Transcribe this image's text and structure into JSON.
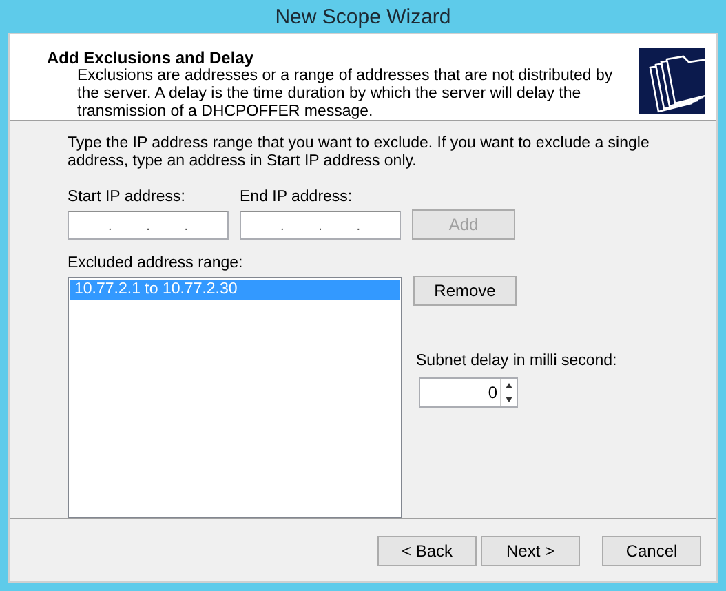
{
  "window": {
    "title": "New Scope Wizard"
  },
  "header": {
    "title": "Add Exclusions and Delay",
    "description": "Exclusions are addresses or a range of addresses that are not distributed by the server. A delay is the time duration by which the server will delay the transmission of a DHCPOFFER message."
  },
  "instructions": "Type the IP address range that you want to exclude. If you want to exclude a single address, type an address in Start IP address only.",
  "start_ip": {
    "label": "Start IP address:",
    "separators": [
      ".",
      ".",
      "."
    ]
  },
  "end_ip": {
    "label": "End IP address:",
    "separators": [
      ".",
      ".",
      "."
    ]
  },
  "add_button": {
    "label": "Add",
    "disabled": true
  },
  "excluded": {
    "label": "Excluded address range:",
    "items": [
      {
        "text": "10.77.2.1 to 10.77.2.30",
        "selected": true
      }
    ]
  },
  "remove_button": {
    "label": "Remove",
    "disabled": false
  },
  "delay": {
    "label": "Subnet delay in milli second:",
    "value": "0"
  },
  "buttons": [
    {
      "label": "< Back",
      "disabled": false
    },
    {
      "label": "Next >",
      "disabled": false
    },
    {
      "label": "Cancel",
      "disabled": false
    }
  ]
}
